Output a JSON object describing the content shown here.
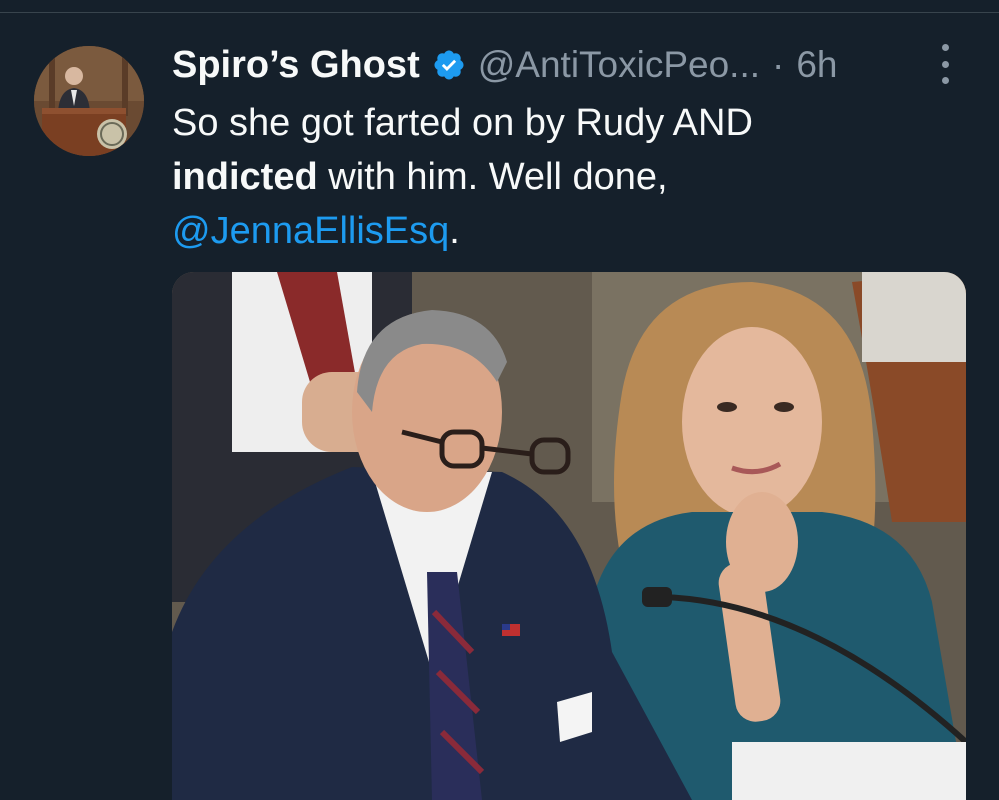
{
  "tweet": {
    "author": {
      "display_name": "Spiro’s Ghost",
      "handle": "@AntiToxicPeo...",
      "verified": true,
      "avatar_icon": "avatar-man-at-podium-icon"
    },
    "separator": "·",
    "time": "6h",
    "more_icon": "more-vertical-icon",
    "text": {
      "part1": "So she got farted on by Rudy AND",
      "bold": "indicted",
      "part2": " with him. Well done,",
      "mention": "@JennaEllisEsq",
      "end": "."
    },
    "media": {
      "type": "photo",
      "icon": "photo-hearing-two-people-icon"
    }
  },
  "colors": {
    "background": "#15202b",
    "text_primary": "#f7f9f9",
    "text_secondary": "#8b98a5",
    "link": "#1d9bf0",
    "verified_badge": "#1d9bf0"
  }
}
